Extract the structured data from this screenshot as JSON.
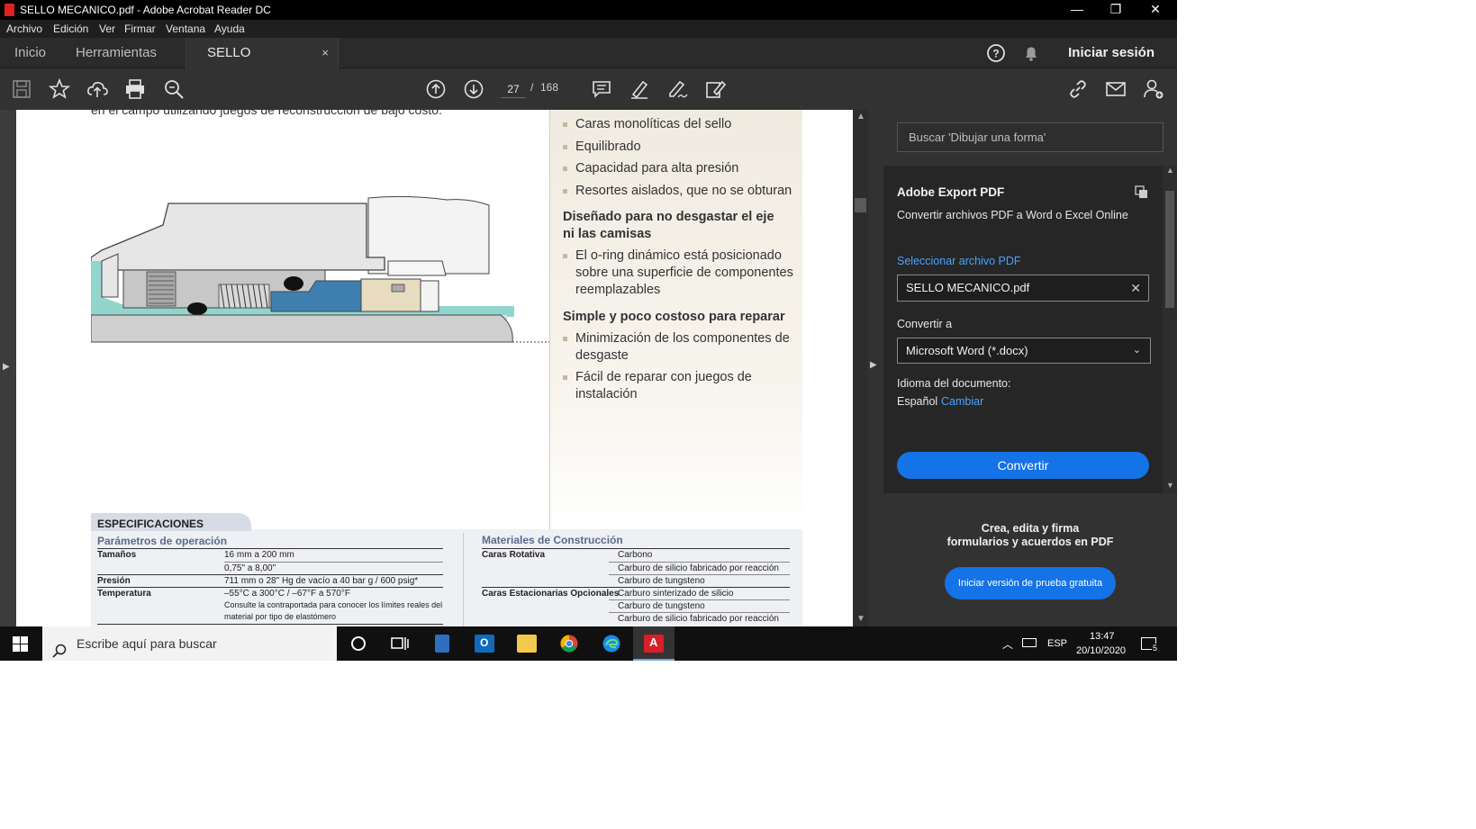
{
  "window": {
    "title": "SELLO MECANICO.pdf - Adobe Acrobat Reader DC",
    "controls": [
      "—",
      "❐",
      "✕"
    ]
  },
  "menu": [
    "Archivo",
    "Edición",
    "Ver",
    "Firmar",
    "Ventana",
    "Ayuda"
  ],
  "tabs": {
    "home": "Inicio",
    "tools": "Herramientas",
    "document": "SELLO MECANICO....",
    "close": "×",
    "signin": "Iniciar sesión"
  },
  "toolbar": {
    "page_current": "27",
    "page_sep": "/",
    "page_total": "168"
  },
  "document": {
    "top_line": "en el campo utilizando juegos de reconstrucción de bajo costo.",
    "bullets_a": [
      "Caras monolíticas del sello",
      "Equilibrado",
      "Capacidad para alta presión",
      "Resortes aislados, que no se obturan"
    ],
    "heading_b": "Diseñado para no desgastar el eje ni las camisas",
    "bullets_b": [
      "El o-ring dinámico está posicionado sobre una superficie de componentes reemplazables"
    ],
    "heading_c": "Simple y poco costoso para reparar",
    "bullets_c": [
      "Minimización de los componentes de desgaste",
      "Fácil de reparar con juegos de instalación"
    ],
    "specs": {
      "title": "ESPECIFICACIONES",
      "left_sub": "Parámetros de operación",
      "rows_left": [
        {
          "label": "Tamaños",
          "value": "16 mm a 200 mm"
        },
        {
          "label": "",
          "value": "0,75\" a 8,00\""
        },
        {
          "label": "Presión",
          "value": "711 mm o 28\" Hg de vacío a 40 bar g / 600 psig*"
        },
        {
          "label": "Temperatura",
          "value": "–55°C a 300°C / –67°F a 570°F"
        },
        {
          "label": "",
          "value": "Consulte la contraportada para conocer los límites reales del"
        },
        {
          "label": "",
          "value": "material por tipo de elastómero"
        }
      ],
      "right_sub": "Materiales de Construcción",
      "rows_right": [
        {
          "label": "Caras Rotativa",
          "value": "Carbono"
        },
        {
          "label": "",
          "value": "Carburo de silicio fabricado por reacción"
        },
        {
          "label": "",
          "value": "Carburo de tungsteno"
        },
        {
          "label": "Caras Estacionarias Opcionales",
          "value": "Carburo sinterizado de silicio"
        },
        {
          "label": "",
          "value": "Carburo de tungsteno"
        },
        {
          "label": "",
          "value": "Carburo de silicio fabricado por reacción"
        }
      ]
    }
  },
  "sidepanel": {
    "search_placeholder": "Buscar 'Dibujar una forma'",
    "export_title": "Adobe Export PDF",
    "export_desc": "Convertir archivos PDF a Word o Excel Online",
    "select_link": "Seleccionar archivo PDF",
    "file_name": "SELLO MECANICO.pdf",
    "convert_to_label": "Convertir a",
    "convert_to_value": "Microsoft Word (*.docx)",
    "lang_label": "Idioma del documento:",
    "lang_value": "Español",
    "lang_change": "Cambiar",
    "convert_button": "Convertir",
    "promo_line1": "Crea, edita y firma",
    "promo_line2": "formularios y acuerdos en PDF",
    "trial_button": "Iniciar versión de prueba gratuita"
  },
  "taskbar": {
    "search_placeholder": "Escribe aquí para buscar",
    "lang": "ESP",
    "time": "13:47",
    "date": "20/10/2020",
    "notifications": "5"
  }
}
